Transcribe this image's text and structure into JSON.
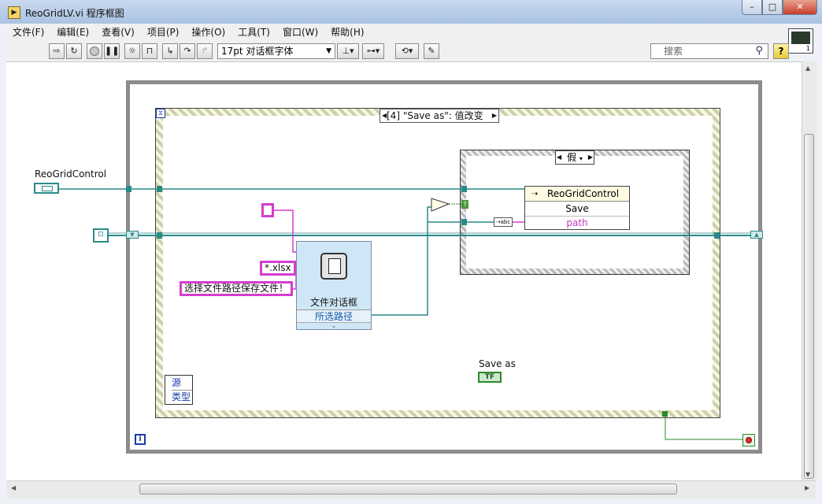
{
  "window": {
    "title": "ReoGridLV.vi 程序框图",
    "icon": "labview-vi-icon"
  },
  "menu": [
    "文件(F)",
    "编辑(E)",
    "查看(V)",
    "项目(P)",
    "操作(O)",
    "工具(T)",
    "窗口(W)",
    "帮助(H)"
  ],
  "toolbar": {
    "font": "17pt 对话框字体",
    "search_placeholder": "搜索",
    "help": "?"
  },
  "vi_icon": {
    "number": "1"
  },
  "diagram": {
    "event_case": "[4] \"Save as\": 值改变",
    "case_selector": "假",
    "control_label": "ReoGridControl",
    "invoke_class": "ReoGridControl",
    "invoke_method": "Save",
    "invoke_param": "path",
    "const_ext": "*.xlsx",
    "const_prompt": "选择文件路径保存文件！",
    "file_dialog_title": "文件对话框",
    "file_dialog_output": "所选路径",
    "event_data_source": "源",
    "event_data_type": "类型",
    "bool_label": "Save as",
    "bool_term": "TF",
    "loop_iteration": "i",
    "compare_symbol": "<?>"
  },
  "colors": {
    "refnum_wire": "#2a8a8a",
    "string_wire": "#d43ed0",
    "bool_wire": "#2a8a2a",
    "path_wire": "#1a5a7a"
  }
}
